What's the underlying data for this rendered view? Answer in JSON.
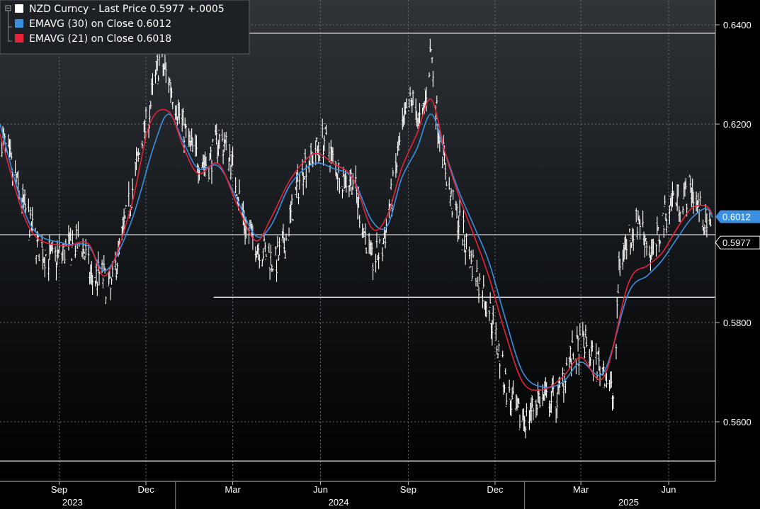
{
  "chart_data": {
    "type": "line",
    "title": "",
    "xlabel": "",
    "ylabel": "",
    "x_range": [
      "2023-07-01",
      "2025-07-20"
    ],
    "ylim": [
      0.548,
      0.645
    ],
    "y_ticks": [
      {
        "label": "0.6400",
        "value": 0.64
      },
      {
        "label": "0.6200",
        "value": 0.62
      },
      {
        "label": "0.5800",
        "value": 0.58
      },
      {
        "label": "0.5600",
        "value": 0.56
      }
    ],
    "x_ticks": [
      {
        "label": "Sep",
        "date": "2023-09-01"
      },
      {
        "label": "Dec",
        "date": "2023-12-01"
      },
      {
        "label": "Mar",
        "date": "2024-03-01"
      },
      {
        "label": "Jun",
        "date": "2024-06-01"
      },
      {
        "label": "Sep",
        "date": "2024-09-01"
      },
      {
        "label": "Dec",
        "date": "2024-12-01"
      },
      {
        "label": "Mar",
        "date": "2025-03-01"
      },
      {
        "label": "Jun",
        "date": "2025-06-01"
      }
    ],
    "years": [
      {
        "label": "2023",
        "date": "2023-09-15"
      },
      {
        "label": "2024",
        "date": "2024-06-20"
      },
      {
        "label": "2025",
        "date": "2025-04-20"
      }
    ],
    "year_dividers": [
      "2024-01-01",
      "2025-01-01"
    ],
    "grid": true,
    "legend_position": "top-left",
    "legend": [
      {
        "text": "NZD Curncy - Last Price 0.5977 +.0005",
        "color": "#ffffff"
      },
      {
        "text": "EMAVG (30) on Close 0.6012",
        "color": "#3a8fe0"
      },
      {
        "text": "EMAVG (21) on Close 0.6018",
        "color": "#e8233a"
      }
    ],
    "price_tags": [
      {
        "value": 0.6012,
        "label": "0.6012",
        "bg": "#3a8fe0",
        "fg": "#ffffff"
      },
      {
        "value": 0.5977,
        "label": "0.5977",
        "bg": "#000000",
        "fg": "#ffffff"
      }
    ],
    "reference_lines": [
      {
        "value": 0.6383,
        "from": "2023-07-01"
      },
      {
        "value": 0.5977,
        "from": "2023-07-01"
      },
      {
        "value": 0.5851,
        "from": "2024-02-10"
      },
      {
        "value": 0.5521,
        "from": "2023-07-01"
      }
    ],
    "series": [
      {
        "style": "bars",
        "color": "#ffffff",
        "x": [
          "2023-07-01",
          "2023-07-20",
          "2023-08-10",
          "2023-08-25",
          "2023-09-10",
          "2023-09-25",
          "2023-10-05",
          "2023-10-15",
          "2023-10-25",
          "2023-11-01",
          "2023-11-15",
          "2023-11-25",
          "2023-12-05",
          "2023-12-15",
          "2023-12-25",
          "2024-01-05",
          "2024-01-15",
          "2024-01-25",
          "2024-02-05",
          "2024-02-15",
          "2024-02-25",
          "2024-03-05",
          "2024-03-15",
          "2024-03-25",
          "2024-04-05",
          "2024-04-15",
          "2024-04-25",
          "2024-05-05",
          "2024-05-15",
          "2024-05-25",
          "2024-06-05",
          "2024-06-15",
          "2024-06-25",
          "2024-07-05",
          "2024-07-15",
          "2024-07-25",
          "2024-08-05",
          "2024-08-15",
          "2024-08-25",
          "2024-09-05",
          "2024-09-15",
          "2024-09-25",
          "2024-10-01",
          "2024-10-15",
          "2024-10-25",
          "2024-11-05",
          "2024-11-15",
          "2024-11-25",
          "2024-12-05",
          "2024-12-15",
          "2024-12-25",
          "2025-01-05",
          "2025-01-15",
          "2025-01-25",
          "2025-02-05",
          "2025-02-15",
          "2025-02-25",
          "2025-03-05",
          "2025-03-15",
          "2025-03-25",
          "2025-04-05",
          "2025-04-10",
          "2025-04-20",
          "2025-05-01",
          "2025-05-15",
          "2025-05-25",
          "2025-06-05",
          "2025-06-15",
          "2025-06-25",
          "2025-07-05",
          "2025-07-15"
        ],
        "values": [
          0.6185,
          0.607,
          0.595,
          0.5925,
          0.595,
          0.596,
          0.5885,
          0.59,
          0.586,
          0.593,
          0.605,
          0.615,
          0.623,
          0.633,
          0.629,
          0.622,
          0.616,
          0.613,
          0.612,
          0.617,
          0.615,
          0.608,
          0.599,
          0.596,
          0.594,
          0.592,
          0.596,
          0.605,
          0.612,
          0.614,
          0.617,
          0.612,
          0.609,
          0.609,
          0.6,
          0.592,
          0.595,
          0.606,
          0.618,
          0.625,
          0.619,
          0.635,
          0.622,
          0.605,
          0.6,
          0.593,
          0.588,
          0.583,
          0.574,
          0.565,
          0.561,
          0.561,
          0.565,
          0.564,
          0.565,
          0.572,
          0.574,
          0.576,
          0.572,
          0.571,
          0.564,
          0.592,
          0.597,
          0.601,
          0.593,
          0.6,
          0.605,
          0.605,
          0.607,
          0.602,
          0.5977
        ]
      },
      {
        "name": "EMAVG (30)",
        "color": "#3a8fe0",
        "x": [
          "2023-07-01",
          "2023-08-01",
          "2023-09-05",
          "2023-10-01",
          "2023-10-20",
          "2023-11-15",
          "2023-12-10",
          "2023-12-25",
          "2024-01-10",
          "2024-01-25",
          "2024-02-15",
          "2024-03-05",
          "2024-03-25",
          "2024-04-10",
          "2024-05-01",
          "2024-05-25",
          "2024-06-15",
          "2024-07-05",
          "2024-07-25",
          "2024-08-10",
          "2024-08-25",
          "2024-09-10",
          "2024-09-25",
          "2024-10-10",
          "2024-10-25",
          "2024-11-10",
          "2024-11-25",
          "2024-12-10",
          "2024-12-30",
          "2025-01-20",
          "2025-02-10",
          "2025-03-01",
          "2025-03-25",
          "2025-04-20",
          "2025-05-10",
          "2025-05-25",
          "2025-06-10",
          "2025-06-25",
          "2025-07-10",
          "2025-07-17"
        ],
        "values": [
          0.62,
          0.6,
          0.596,
          0.5955,
          0.5905,
          0.6,
          0.616,
          0.622,
          0.616,
          0.611,
          0.6115,
          0.605,
          0.5975,
          0.5995,
          0.608,
          0.612,
          0.611,
          0.609,
          0.6005,
          0.5995,
          0.609,
          0.615,
          0.622,
          0.614,
          0.606,
          0.599,
          0.592,
          0.582,
          0.57,
          0.567,
          0.568,
          0.572,
          0.57,
          0.586,
          0.5895,
          0.5925,
          0.597,
          0.601,
          0.603,
          0.6012
        ]
      },
      {
        "name": "EMAVG (21)",
        "color": "#e8233a",
        "x": [
          "2023-07-01",
          "2023-08-01",
          "2023-09-05",
          "2023-10-01",
          "2023-10-20",
          "2023-11-15",
          "2023-12-05",
          "2023-12-25",
          "2024-01-10",
          "2024-01-25",
          "2024-02-15",
          "2024-03-05",
          "2024-03-25",
          "2024-04-10",
          "2024-05-01",
          "2024-05-25",
          "2024-06-15",
          "2024-07-05",
          "2024-07-25",
          "2024-08-10",
          "2024-08-25",
          "2024-09-10",
          "2024-09-25",
          "2024-10-10",
          "2024-10-25",
          "2024-11-10",
          "2024-11-25",
          "2024-12-10",
          "2024-12-30",
          "2025-01-20",
          "2025-02-10",
          "2025-03-01",
          "2025-03-25",
          "2025-04-20",
          "2025-05-10",
          "2025-05-25",
          "2025-06-10",
          "2025-06-25",
          "2025-07-10",
          "2025-07-17"
        ],
        "values": [
          0.618,
          0.599,
          0.5955,
          0.596,
          0.5895,
          0.603,
          0.62,
          0.6225,
          0.615,
          0.61,
          0.612,
          0.604,
          0.5965,
          0.601,
          0.609,
          0.614,
          0.612,
          0.609,
          0.599,
          0.6015,
          0.611,
          0.618,
          0.625,
          0.614,
          0.605,
          0.597,
          0.589,
          0.579,
          0.568,
          0.5665,
          0.569,
          0.573,
          0.569,
          0.588,
          0.5915,
          0.594,
          0.599,
          0.603,
          0.6035,
          0.6018
        ]
      }
    ]
  }
}
